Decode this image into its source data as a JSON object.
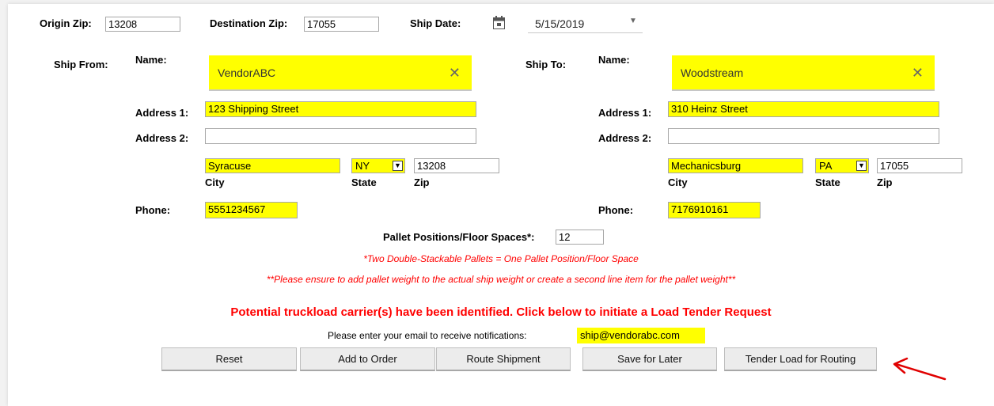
{
  "header": {
    "origin_zip_label": "Origin Zip:",
    "origin_zip_value": "13208",
    "destination_zip_label": "Destination Zip:",
    "destination_zip_value": "17055",
    "ship_date_label": "Ship Date:",
    "ship_date_value": "5/15/2019"
  },
  "ship_from": {
    "title": "Ship From:",
    "name_label": "Name:",
    "name_value": "VendorABC",
    "address1_label": "Address 1:",
    "address1_value": "123 Shipping Street",
    "address2_label": "Address 2:",
    "address2_value": "",
    "city_value": "Syracuse",
    "state_value": "NY",
    "zip_value": "13208",
    "city_label": "City",
    "state_label": "State",
    "zip_label": "Zip",
    "phone_label": "Phone:",
    "phone_value": "5551234567"
  },
  "ship_to": {
    "title": "Ship To:",
    "name_label": "Name:",
    "name_value": "Woodstream",
    "address1_label": "Address 1:",
    "address1_value": "310 Heinz Street",
    "address2_label": "Address 2:",
    "address2_value": "",
    "city_value": "Mechanicsburg",
    "state_value": "PA",
    "zip_value": "17055",
    "city_label": "City",
    "state_label": "State",
    "zip_label": "Zip",
    "phone_label": "Phone:",
    "phone_value": "7176910161"
  },
  "pallets": {
    "label": "Pallet Positions/Floor Spaces*:",
    "value": "12",
    "note1": "*Two Double-Stackable Pallets = One Pallet Position/Floor Space",
    "note2": "**Please ensure to add pallet weight to the actual ship weight or create a second line item for the pallet weight**"
  },
  "alert": "Potential truckload carrier(s) have been identified. Click below to initiate a Load Tender Request",
  "email": {
    "label": "Please enter your email to receive notifications:",
    "value": "ship@vendorabc.com"
  },
  "buttons": {
    "reset": "Reset",
    "add_to_order": "Add to Order",
    "route_shipment": "Route Shipment",
    "save_for_later": "Save for Later",
    "tender_load": "Tender Load for Routing"
  },
  "colors": {
    "highlight": "#ffff00",
    "alert": "#ff0000",
    "arrow": "#e00000"
  },
  "icons": {
    "calendar": "calendar-icon",
    "dropdown": "caret-down-icon",
    "clear": "clear-x-icon",
    "annotation": "red-arrow-annotation"
  }
}
